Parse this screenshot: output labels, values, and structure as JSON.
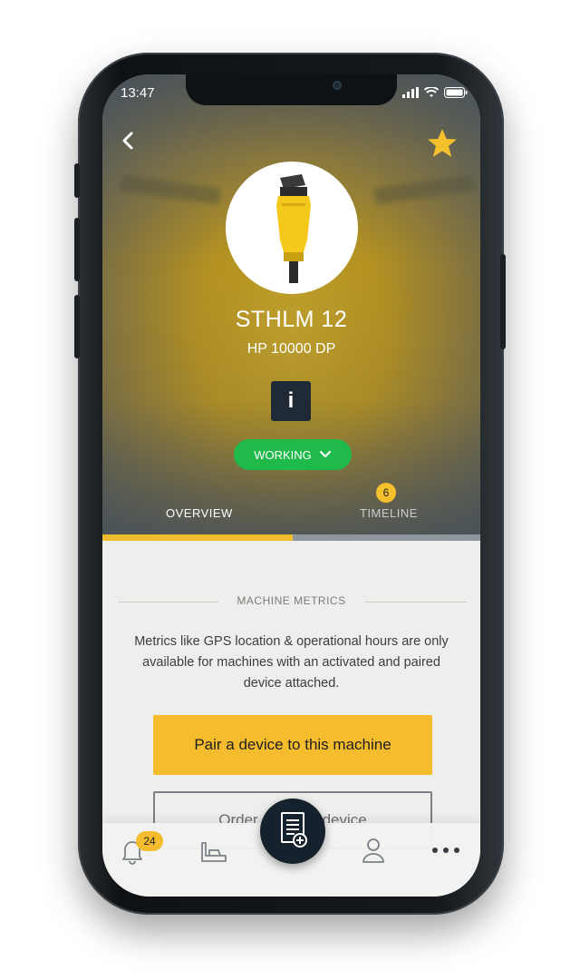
{
  "status_bar": {
    "time": "13:47"
  },
  "machine": {
    "name": "STHLM 12",
    "model": "HP 10000 DP",
    "info_label": "i",
    "status": "WORKING"
  },
  "tabs": [
    {
      "label": "OVERVIEW",
      "active": true
    },
    {
      "label": "TIMELINE",
      "badge": "6"
    }
  ],
  "metrics": {
    "section_title": "MACHINE METRICS",
    "description": "Metrics like GPS location & operational hours are only available for machines with an activated and paired device attached.",
    "pair_button": "Pair a device to this machine",
    "order_button": "Order a paired device"
  },
  "bottom_nav": {
    "notifications_count": "24"
  },
  "colors": {
    "accent": "#f5bd2e",
    "status_green": "#1fba4a",
    "dark": "#15222d"
  }
}
